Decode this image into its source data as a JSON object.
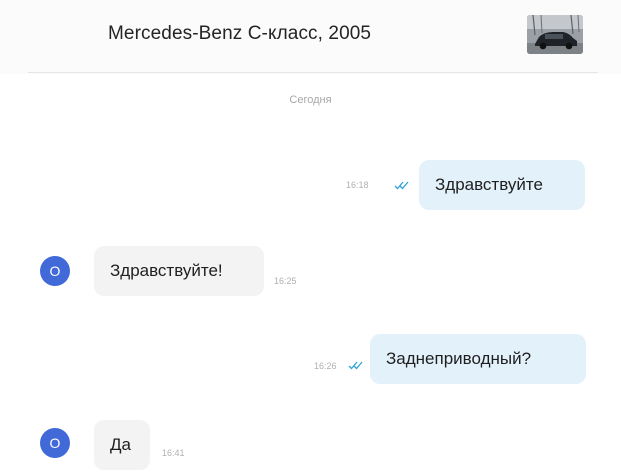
{
  "header": {
    "title": "Mercedes-Benz C-класс, 2005",
    "thumbnail_icon": "car-photo-thumbnail"
  },
  "chat": {
    "date_separator": "Сегодня",
    "messages": [
      {
        "direction": "outgoing",
        "text": "Здравствуйте",
        "time": "16:18",
        "read": true
      },
      {
        "direction": "incoming",
        "text": "Здравствуйте!",
        "time": "16:25",
        "avatar_letter": "O"
      },
      {
        "direction": "outgoing",
        "text": "Заднеприводный?",
        "time": "16:26",
        "read": true
      },
      {
        "direction": "incoming",
        "text": "Да",
        "time": "16:41",
        "avatar_letter": "O"
      }
    ]
  },
  "colors": {
    "outgoing_bubble": "#e3f1fb",
    "incoming_bubble": "#f3f3f3",
    "avatar": "#4169d8",
    "read_ticks": "#2fa3d8"
  }
}
